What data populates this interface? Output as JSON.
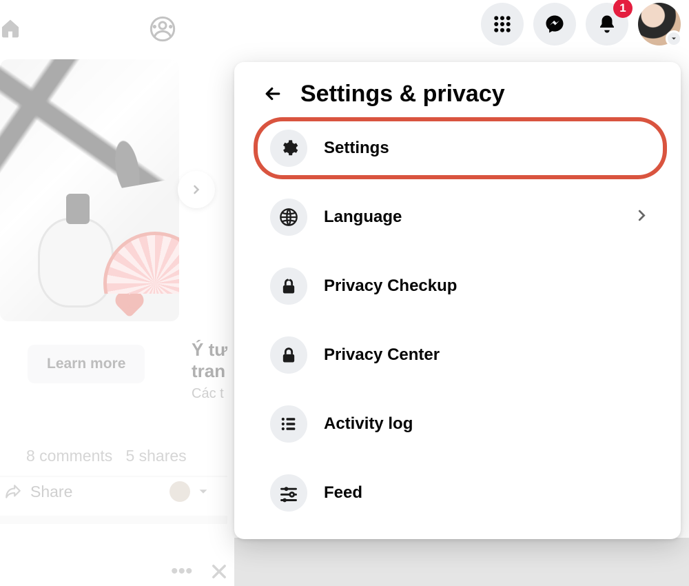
{
  "topnav": {
    "notification_badge": "1"
  },
  "panel": {
    "title": "Settings & privacy",
    "items": [
      {
        "label": "Settings",
        "has_chevron": false,
        "highlighted": true
      },
      {
        "label": "Language",
        "has_chevron": true,
        "highlighted": false
      },
      {
        "label": "Privacy Checkup",
        "has_chevron": false,
        "highlighted": false
      },
      {
        "label": "Privacy Center",
        "has_chevron": false,
        "highlighted": false
      },
      {
        "label": "Activity log",
        "has_chevron": false,
        "highlighted": false
      },
      {
        "label": "Feed",
        "has_chevron": false,
        "highlighted": false
      }
    ]
  },
  "feed_bg": {
    "learn_more": "Learn more",
    "card2_title": "Ý tư",
    "card2_title_line2": "tran",
    "card2_sub": "Các t",
    "comments": "8 comments",
    "shares": "5 shares",
    "share": "Share"
  }
}
